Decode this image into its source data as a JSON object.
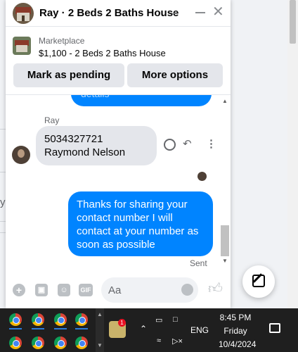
{
  "chat": {
    "title": "Ray · 2 Beds 2 Baths House",
    "listing_label": "Marketplace",
    "listing_item": "$1,100 - 2 Beds 2 Baths House",
    "btn_pending": "Mark as pending",
    "btn_more": "More options"
  },
  "messages": {
    "prev_fragment": "details",
    "sender_name": "Ray",
    "incoming_text": "5034327721 Raymond Nelson",
    "outgoing_text": "Thanks for sharing your contact number I will contact at your number as soon as possible",
    "status": "Sent"
  },
  "composer": {
    "placeholder": "Aa",
    "gif_label": "GIF"
  },
  "background": {
    "fragment": "y"
  },
  "taskbar": {
    "lang": "ENG",
    "time": "8:45 PM",
    "day": "Friday",
    "date": "10/4/2024",
    "badge": "1"
  },
  "colors": {
    "accent": "#0084ff",
    "bubble_in": "#e4e6eb",
    "taskbar": "#1f1f1f"
  }
}
